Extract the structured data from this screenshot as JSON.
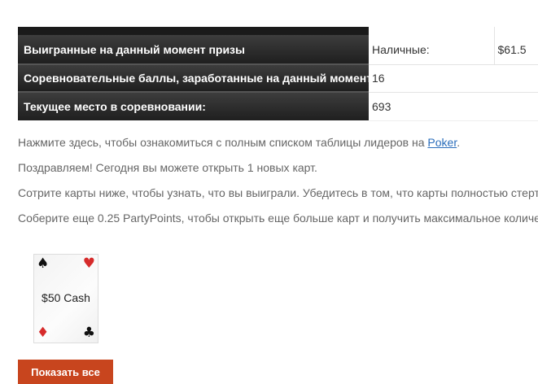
{
  "stats": {
    "prizes_label": "Выигранные на данный момент призы",
    "prizes_type": "Наличные:",
    "prizes_value": "$61.5",
    "points_label": "Соревновательные баллы, заработанные на данный момент:",
    "points_value": "16",
    "place_label": "Текущее место в соревновании:",
    "place_value": "693"
  },
  "info": {
    "leaderboard_prefix": "Нажмите здесь, чтобы ознакомиться с полным списком таблицы лидеров на ",
    "leaderboard_link": "Poker",
    "leaderboard_suffix": ".",
    "congrats": "Поздравляем! Сегодня вы можете открыть 1 новых карт.",
    "scratch_hint": "Сотрите карты ниже, чтобы узнать, что вы выиграли. Убедитесь в том, что карты полностью стерты",
    "collect_hint": "Соберите еще 0.25 PartyPoints, чтобы открыть еще больше карт и получить максимальное количество"
  },
  "card": {
    "prize": "$50 Cash",
    "suits": [
      "♠",
      "♥",
      "♦",
      "♣"
    ]
  },
  "buttons": {
    "show_all": "Показать все"
  },
  "colors": {
    "header_dark": "#1f1f1f",
    "button": "#c8451e",
    "link": "#2a6dbb",
    "suit_red": "#d62b2b"
  }
}
